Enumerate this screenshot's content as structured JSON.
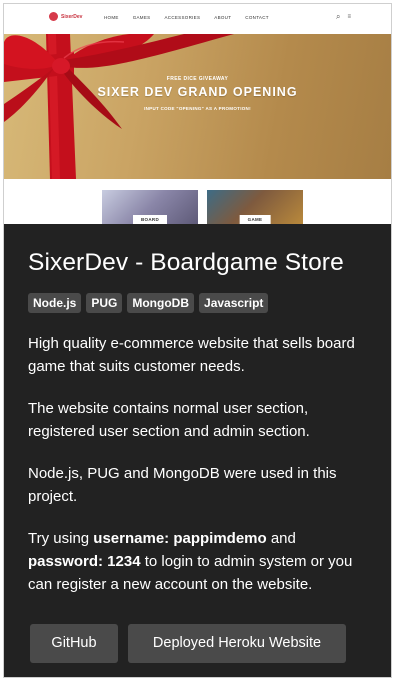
{
  "preview": {
    "logo_text": "SixerDev",
    "nav": [
      "HOME",
      "GAMES",
      "ACCESSORIES",
      "ABOUT",
      "CONTACT"
    ],
    "nav_icons": [
      "search-icon",
      "menu-icon"
    ],
    "hero": {
      "kicker": "FREE DICE GIVEAWAY",
      "title": "SIXER DEV GRAND OPENING",
      "sub": "INPUT CODE \"OPENING\" AS A PROMOTION!"
    },
    "thumbs": [
      "BOARD",
      "GAME"
    ],
    "colors": {
      "ribbon": "#d0101e",
      "hero_gold": "#caa464",
      "logo": "#d63a4a"
    }
  },
  "panel": {
    "title": "SixerDev - Boardgame Store",
    "tags": [
      "Node.js",
      "PUG",
      "MongoDB",
      "Javascript"
    ],
    "p1": "High quality e-commerce website that sells board game that suits customer needs.",
    "p2": "The website contains normal user section, registered user section and admin section.",
    "p3": "Node.js, PUG and MongoDB were used in this project.",
    "p4": {
      "t1": "Try using ",
      "b1": "username: pappimdemo",
      "t2": " and ",
      "b2": "password: 1234",
      "t3": " to login to admin system or you can register a new account on the website."
    },
    "buttons": {
      "github": "GitHub",
      "deployed": "Deployed Heroku Website"
    },
    "colors": {
      "background": "#222222",
      "tag": "#4a4a4a",
      "button": "#4a4a4a"
    }
  }
}
